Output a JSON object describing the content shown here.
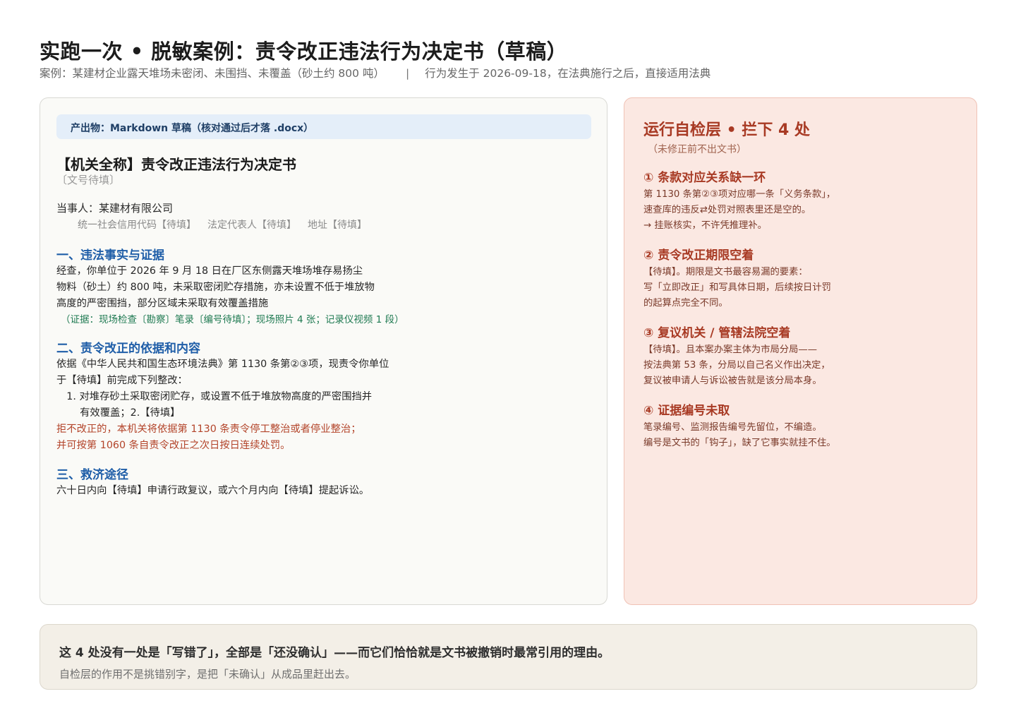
{
  "header": {
    "title": "实跑一次 • 脱敏案例：责令改正违法行为决定书（草稿）",
    "case": "案例：某建材企业露天堆场未密闭、未围挡、未覆盖（砂土约 800 吨）",
    "separator": "|",
    "note": "行为发生于 2026-09-18，在法典施行之后，直接适用法典"
  },
  "document": {
    "output_banner": "产出物：Markdown 草稿（核对通过后才落 .docx）",
    "title": "【机关全称】责令改正违法行为决定书",
    "doc_number": "〔文号待填〕",
    "party": "当事人：某建材有限公司",
    "party_meta": [
      "统一社会信用代码【待填】",
      "法定代表人【待填】",
      "地址【待填】"
    ],
    "section1": {
      "heading": "一、违法事实与证据",
      "lines": [
        "经查，你单位于 2026 年 9 月 18 日在厂区东侧露天堆场堆存易扬尘",
        "物料（砂土）约 800 吨，未采取密闭贮存措施，亦未设置不低于堆放物",
        "高度的严密围挡，部分区域未采取有效覆盖措施"
      ],
      "evidence": "（证据：现场检查〔勘察〕笔录〔编号待填〕；现场照片 4 张；记录仪视频 1 段）"
    },
    "section2": {
      "heading": "二、责令改正的依据和内容",
      "lines": [
        "依据《中华人民共和国生态环境法典》第 1130 条第②③项，现责令你单位",
        "于【待填】前完成下列整改：",
        "　1. 对堆存砂土采取密闭贮存，或设置不低于堆放物高度的严密围挡并",
        "　　 有效覆盖；2.【待填】"
      ],
      "penalty": [
        "拒不改正的，本机关将依据第 1130 条责令停工整治或者停业整治；",
        "并可按第 1060 条自责令改正之次日按日连续处罚。"
      ]
    },
    "section3": {
      "heading": "三、救济途径",
      "line": "六十日内向【待填】申请行政复议，或六个月内向【待填】提起诉讼。"
    }
  },
  "selfcheck": {
    "title": "运行自检层 • 拦下 4 处",
    "subtitle": "（未修正前不出文书）",
    "issues": [
      {
        "heading": "① 条款对应关系缺一环",
        "lines": [
          "第 1130 条第②③项对应哪一条「义务条款」，",
          "速查库的违反⇄处罚对照表里还是空的。",
          "→ 挂账核实，不许凭推理补。"
        ]
      },
      {
        "heading": "② 责令改正期限空着",
        "lines": [
          "【待填】。期限是文书最容易漏的要素：",
          "写「立即改正」和写具体日期，后续按日计罚",
          "的起算点完全不同。"
        ]
      },
      {
        "heading": "③ 复议机关 / 管辖法院空着",
        "lines": [
          "【待填】。且本案办案主体为市局分局——",
          "按法典第 53 条，分局以自己名义作出决定，",
          "复议被申请人与诉讼被告就是该分局本身。"
        ]
      },
      {
        "heading": "④ 证据编号未取",
        "lines": [
          "笔录编号、监测报告编号先留位，不编造。",
          "编号是文书的「钩子」，缺了它事实就挂不住。"
        ]
      }
    ]
  },
  "footer": {
    "main": "这 4 处没有一处是「写错了」，全部是「还没确认」——而它们恰恰就是文书被撤销时最常引用的理由。",
    "sub": "自检层的作用不是挑错别字，是把「未确认」从成品里赶出去。"
  }
}
